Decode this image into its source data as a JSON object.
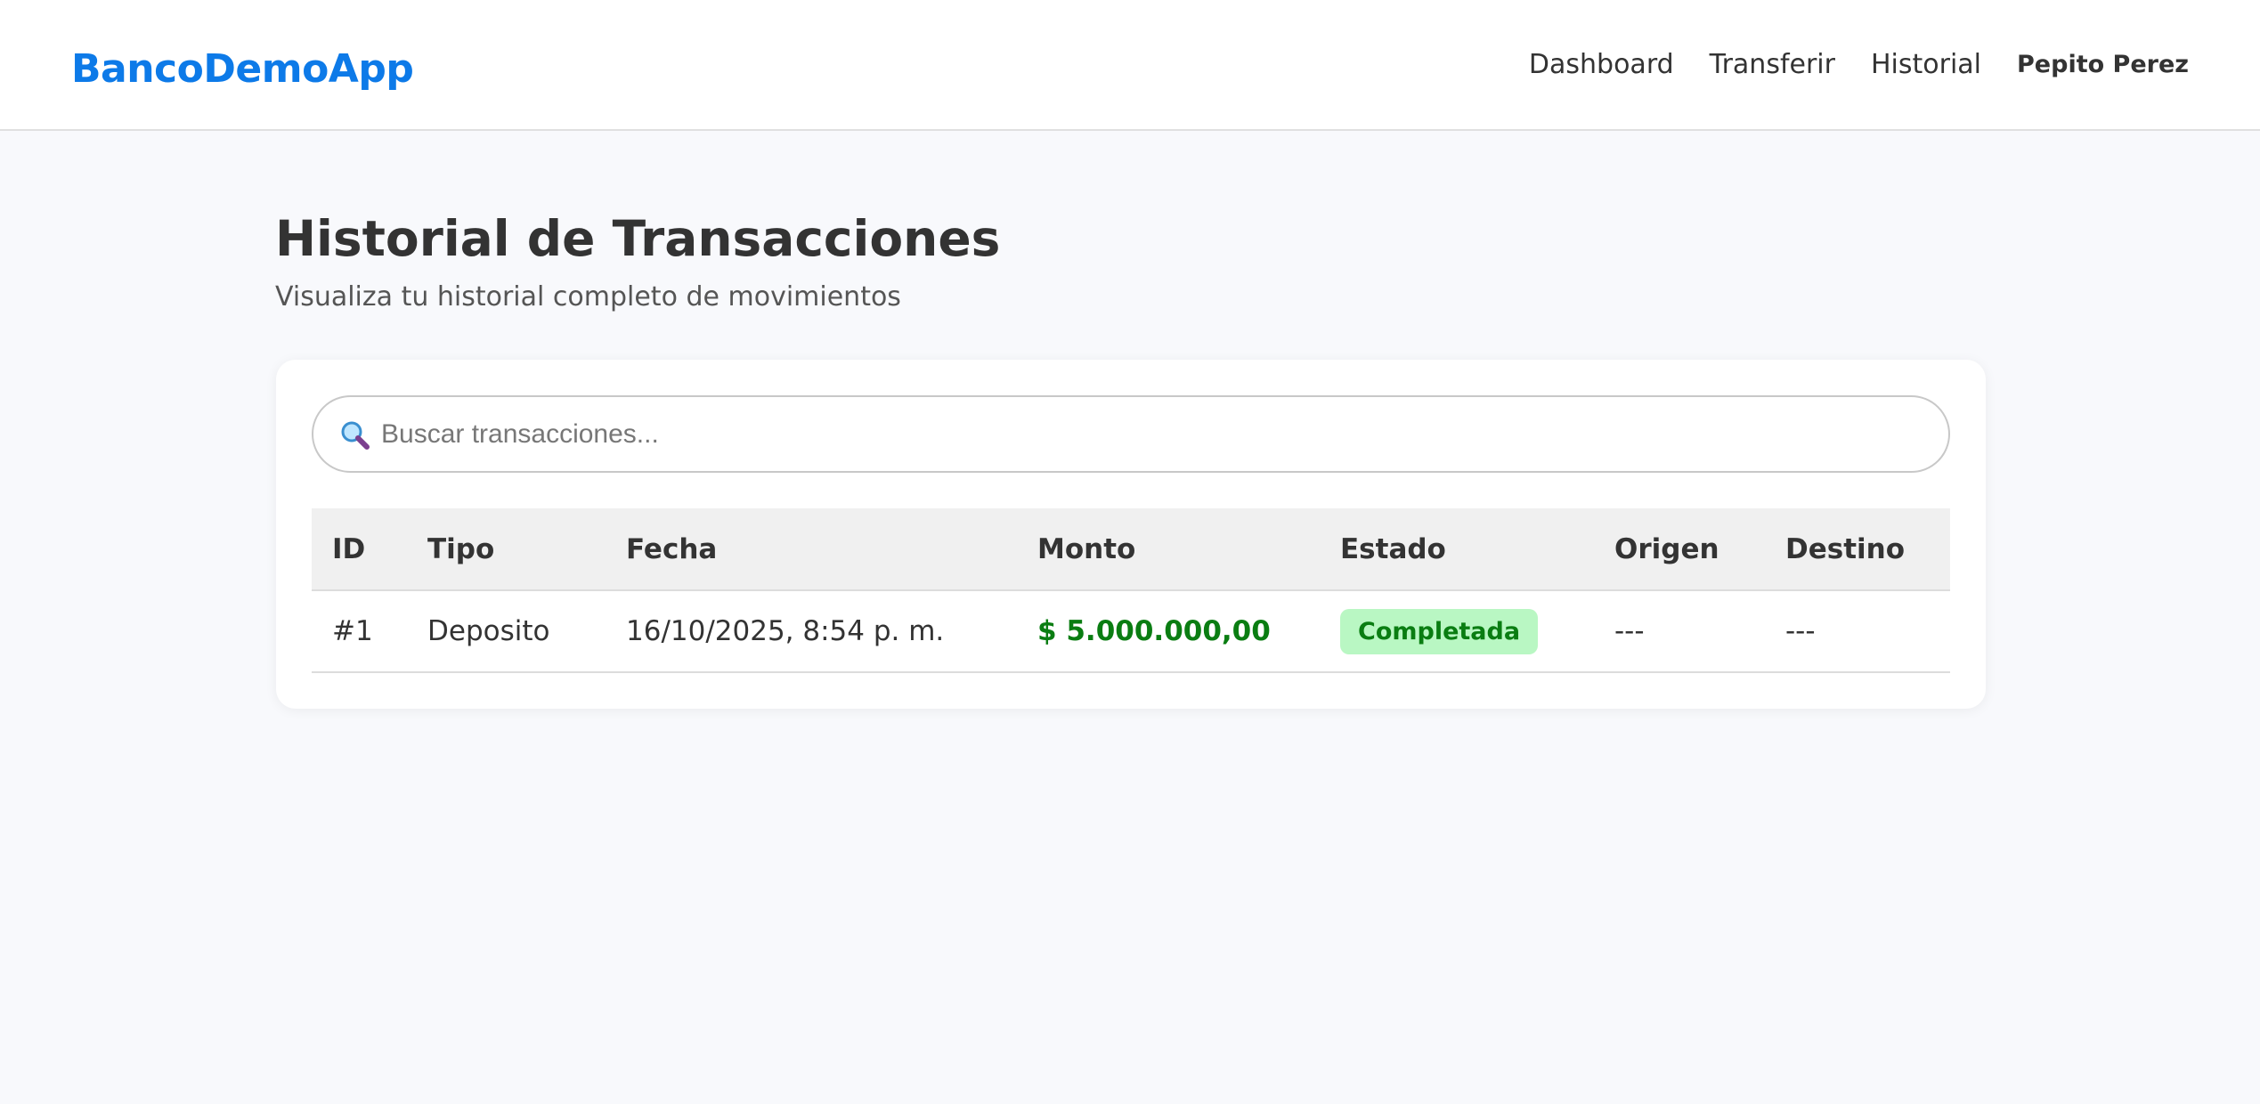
{
  "brand": "BancoDemoApp",
  "nav": {
    "links": [
      "Dashboard",
      "Transferir",
      "Historial"
    ],
    "user": "Pepito Perez"
  },
  "page": {
    "title": "Historial de Transacciones",
    "subtitle": "Visualiza tu historial completo de movimientos"
  },
  "search": {
    "placeholder": "Buscar transacciones...",
    "value": "",
    "icon": "search-icon"
  },
  "table": {
    "columns": [
      "ID",
      "Tipo",
      "Fecha",
      "Monto",
      "Estado",
      "Origen",
      "Destino"
    ],
    "rows": [
      {
        "id": "#1",
        "tipo": "Deposito",
        "fecha": "16/10/2025, 8:54 p. m.",
        "monto": "$ 5.000.000,00",
        "estado": "Completada",
        "origen": "---",
        "destino": "---"
      }
    ]
  },
  "colors": {
    "brand": "#0d7ae8",
    "amount_positive": "#0a7d12",
    "status_completed_bg": "#b9f7c3",
    "status_completed_text": "#0a7d12"
  }
}
